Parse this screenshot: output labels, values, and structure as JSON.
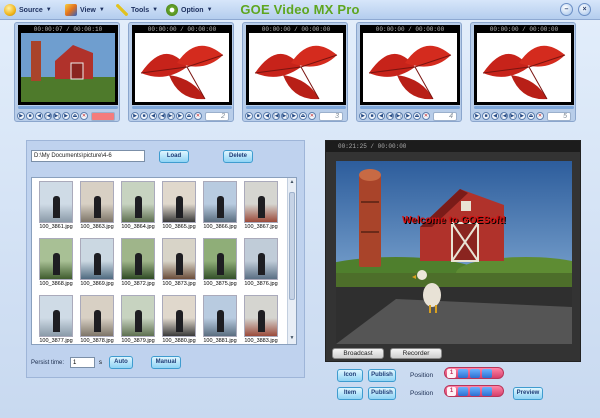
{
  "app": {
    "title": "GOE Video MX Pro"
  },
  "menu": [
    {
      "label": "Source",
      "icon": "source-icon",
      "color": "#f0b51a"
    },
    {
      "label": "View",
      "icon": "view-icon",
      "color": "#e2711d"
    },
    {
      "label": "Tools",
      "icon": "tools-icon",
      "color": "#e1c21f"
    },
    {
      "label": "Option",
      "icon": "option-icon",
      "color": "#6aa62c"
    }
  ],
  "window_buttons": {
    "minimize": "–",
    "close": "×"
  },
  "previews": [
    {
      "time": "00:00:07 / 00:00:10",
      "number": "",
      "active": true,
      "image": "farm-scene"
    },
    {
      "time": "00:00:00 / 00:00:00",
      "number": "2",
      "active": false,
      "image": "red-leaves"
    },
    {
      "time": "00:00:00 / 00:00:00",
      "number": "3",
      "active": false,
      "image": "red-leaves"
    },
    {
      "time": "00:00:00 / 00:00:00",
      "number": "4",
      "active": false,
      "image": "red-leaves"
    },
    {
      "time": "00:00:00 / 00:00:00",
      "number": "5",
      "active": false,
      "image": "red-leaves"
    }
  ],
  "picture_panel": {
    "path": "D:\\My Documents\\picture\\4-6",
    "load_label": "Load",
    "delete_label": "Delete",
    "thumbnails": [
      "100_3861.jpg",
      "100_3863.jpg",
      "100_3864.jpg",
      "100_3865.jpg",
      "100_3866.jpg",
      "100_3867.jpg",
      "100_3868.jpg",
      "100_3869.jpg",
      "100_3872.jpg",
      "100_3873.jpg",
      "100_3875.jpg",
      "100_3876.jpg",
      "100_3877.jpg",
      "100_3878.jpg",
      "100_3879.jpg",
      "100_3880.jpg",
      "100_3881.jpg",
      "100_3883.jpg"
    ],
    "persist_label": "Persist time:",
    "persist_value": "1",
    "persist_unit": "s",
    "auto_label": "Auto",
    "manual_label": "Manual"
  },
  "player": {
    "time": "00:21:25 / 00:00:00",
    "overlay_text": "Welcome to GOESoft!",
    "broadcast_label": "Broadcast",
    "recorder_label": "Recorder"
  },
  "bottom": {
    "icon_label": "Icon",
    "item_label": "Item",
    "publish_label": "Publish",
    "position_label": "Position",
    "position_number": "1",
    "preview_label": "Preview"
  }
}
